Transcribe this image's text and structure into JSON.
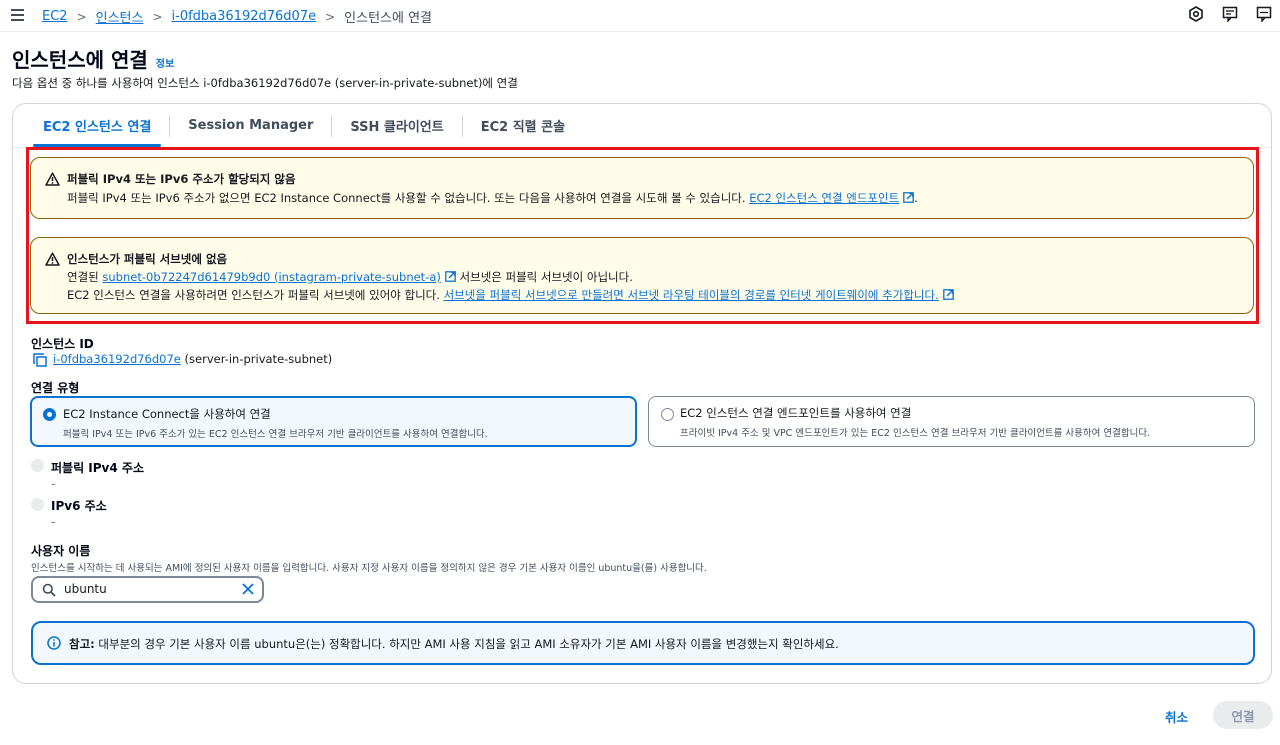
{
  "breadcrumb": [
    "EC2",
    "인스턴스",
    "i-0fdba36192d76d07e",
    "인스턴스에 연결"
  ],
  "header": {
    "title": "인스턴스에 연결",
    "info": "정보",
    "description": "다음 옵션 중 하나를 사용하여 인스턴스 i-0fdba36192d76d07e (server-in-private-subnet)에 연결"
  },
  "tabs": [
    "EC2 인스턴스 연결",
    "Session Manager",
    "SSH 클라이언트",
    "EC2 직렬 콘솔"
  ],
  "alerts": {
    "no_public_ip": {
      "title": "퍼블릭 IPv4 또는 IPv6 주소가 할당되지 않음",
      "text": "퍼블릭 IPv4 또는 IPv6 주소가 없으면 EC2 Instance Connect를 사용할 수 없습니다. 또는 다음을 사용하여 연결을 시도해 볼 수 있습니다.",
      "link": "EC2 인스턴스 연결 엔드포인트",
      "end": "."
    },
    "no_public_subnet": {
      "title": "인스턴스가 퍼블릭 서브넷에 없음",
      "prefix": "연결된",
      "subnet_link": "subnet-0b72247d61479b9d0 (instagram-private-subnet-a)",
      "suffix": "서브넷은 퍼블릭 서브넷이 아닙니다.",
      "line2": "EC2 인스턴스 연결을 사용하려면 인스턴스가 퍼블릭 서브넷에 있어야 합니다.",
      "line2_link": "서브넷을 퍼블릭 서브넷으로 만들려면 서브넷 라우팅 테이블의 경로를 인터넷 게이트웨이에 추가합니다."
    }
  },
  "instance": {
    "label": "인스턴스 ID",
    "id": "i-0fdba36192d76d07e",
    "name": "(server-in-private-subnet)"
  },
  "connection_type": {
    "label": "연결 유형",
    "options": [
      {
        "title": "EC2 Instance Connect을 사용하여 연결",
        "desc": "퍼블릭 IPv4 또는 IPv6 주소가 있는 EC2 인스턴스 연결 브라우저 기반 클라이언트를 사용하여 연결합니다.",
        "selected": true
      },
      {
        "title": "EC2 인스턴스 연결 엔드포인트를 사용하여 연결",
        "desc": "프라이빗 IPv4 주소 및 VPC 엔드포인트가 있는 EC2 인스턴스 연결 브라우저 기반 클라이언트를 사용하여 연결합니다.",
        "selected": false
      }
    ]
  },
  "addresses": {
    "ipv4_label": "퍼블릭 IPv4 주소",
    "ipv4_value": "–",
    "ipv6_label": "IPv6 주소",
    "ipv6_value": "–"
  },
  "username": {
    "label": "사용자 이름",
    "desc": "인스턴스를 시작하는 데 사용되는 AMI에 정의된 사용자 이름을 입력합니다. 사용자 지정 사용자 이름을 정의하지 않은 경우 기본 사용자 이름인 ubuntu을(를) 사용합니다.",
    "value": "ubuntu"
  },
  "note": {
    "bold": "참고:",
    "text": "대부분의 경우 기본 사용자 이름 ubuntu은(는) 정확합니다. 하지만 AMI 사용 지침을 읽고 AMI 소유자가 기본 AMI 사용자 이름을 변경했는지 확인하세요."
  },
  "footer": {
    "cancel": "취소",
    "connect": "연결"
  },
  "colors": {
    "link": "#0972d3",
    "warning_border": "#8d6605",
    "warning_bg": "#fffce9",
    "highlight": "#e8141b"
  }
}
